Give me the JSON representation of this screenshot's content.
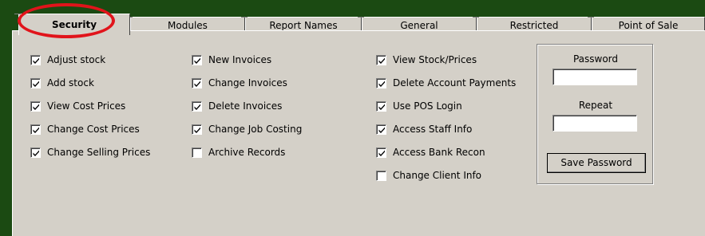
{
  "tabs": [
    {
      "label": "Security",
      "active": true
    },
    {
      "label": "Modules",
      "active": false
    },
    {
      "label": "Report Names",
      "active": false
    },
    {
      "label": "General",
      "active": false
    },
    {
      "label": "Restricted",
      "active": false
    },
    {
      "label": "Point of Sale",
      "active": false
    }
  ],
  "columns": [
    [
      {
        "label": "Adjust stock",
        "checked": true
      },
      {
        "label": "Add stock",
        "checked": true
      },
      {
        "label": "View Cost Prices",
        "checked": true
      },
      {
        "label": "Change Cost Prices",
        "checked": true
      },
      {
        "label": "Change Selling Prices",
        "checked": true
      }
    ],
    [
      {
        "label": "New Invoices",
        "checked": true
      },
      {
        "label": "Change Invoices",
        "checked": true
      },
      {
        "label": "Delete Invoices",
        "checked": true
      },
      {
        "label": "Change Job Costing",
        "checked": true
      },
      {
        "label": "Archive Records",
        "checked": false
      }
    ],
    [
      {
        "label": "View Stock/Prices",
        "checked": true
      },
      {
        "label": "Delete Account Payments",
        "checked": true
      },
      {
        "label": "Use POS Login",
        "checked": true
      },
      {
        "label": "Access Staff Info",
        "checked": true
      },
      {
        "label": "Access Bank Recon",
        "checked": true
      },
      {
        "label": "Change Client Info",
        "checked": false
      }
    ]
  ],
  "password_box": {
    "password_label": "Password",
    "password_value": "",
    "repeat_label": "Repeat",
    "repeat_value": "",
    "save_label": "Save Password"
  },
  "colors": {
    "window_bg": "#d4d0c8",
    "outer_bg": "#1b4a12",
    "highlight": "#e1141b"
  }
}
